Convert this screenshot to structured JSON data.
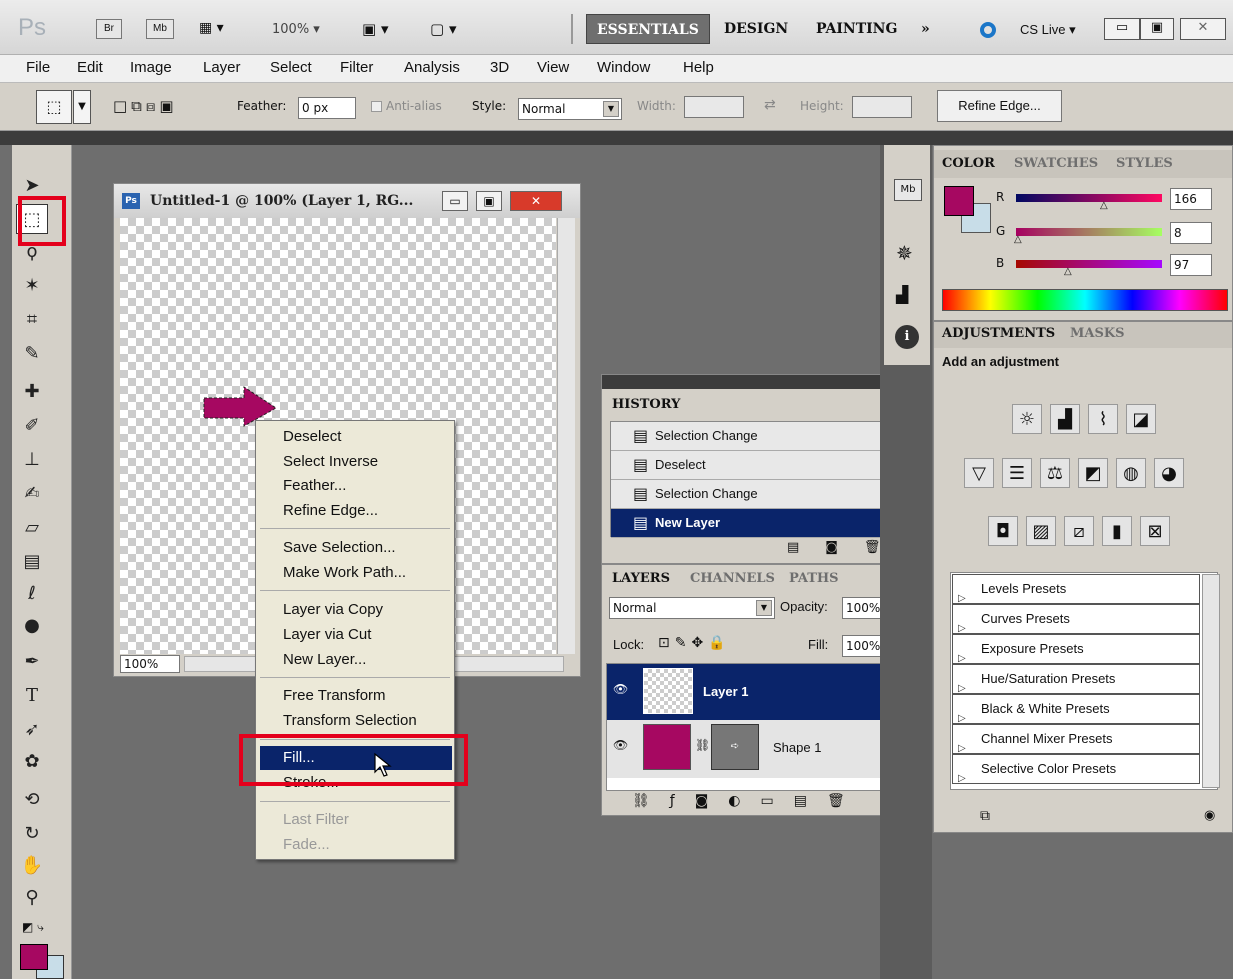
{
  "app_bar": {
    "logo": "Ps",
    "bridge": "Br",
    "minibridge": "Mb",
    "zoom": "100%",
    "workspaces": [
      "ESSENTIALS",
      "DESIGN",
      "PAINTING"
    ],
    "more": "»",
    "cs_live": "CS Live"
  },
  "menu": [
    "File",
    "Edit",
    "Image",
    "Layer",
    "Select",
    "Filter",
    "Analysis",
    "3D",
    "View",
    "Window",
    "Help"
  ],
  "options": {
    "feather_label": "Feather:",
    "feather_value": "0 px",
    "antialias": "Anti-alias",
    "style_label": "Style:",
    "style_value": "Normal",
    "width_label": "Width:",
    "height_label": "Height:",
    "refine_edge": "Refine Edge..."
  },
  "document": {
    "icon": "Ps",
    "title": "Untitled-1 @ 100% (Layer 1, RG...",
    "zoom": "100%"
  },
  "context_menu": {
    "groups": [
      [
        "Deselect",
        "Select Inverse",
        "Feather...",
        "Refine Edge..."
      ],
      [
        "Save Selection...",
        "Make Work Path..."
      ],
      [
        "Layer via Copy",
        "Layer via Cut",
        "New Layer..."
      ],
      [
        "Free Transform",
        "Transform Selection"
      ],
      [
        "Fill...",
        "Stroke..."
      ],
      [
        "Last Filter",
        "Fade..."
      ]
    ]
  },
  "color_panel": {
    "tabs": [
      "COLOR",
      "SWATCHES",
      "STYLES"
    ],
    "r_label": "R",
    "g_label": "G",
    "b_label": "B",
    "r": "166",
    "g": "8",
    "b": "97",
    "foreground": "#a60861",
    "background": "#c8dde8"
  },
  "adjustments": {
    "tabs": [
      "ADJUSTMENTS",
      "MASKS"
    ],
    "heading": "Add an adjustment",
    "presets": [
      "Levels Presets",
      "Curves Presets",
      "Exposure Presets",
      "Hue/Saturation Presets",
      "Black & White Presets",
      "Channel Mixer Presets",
      "Selective Color Presets"
    ]
  },
  "history": {
    "tab": "HISTORY",
    "items": [
      "Selection Change",
      "Deselect",
      "Selection Change",
      "New Layer"
    ]
  },
  "layers": {
    "tabs": [
      "LAYERS",
      "CHANNELS",
      "PATHS"
    ],
    "blend": "Normal",
    "opacity_label": "Opacity:",
    "opacity": "100%",
    "lock_label": "Lock:",
    "fill_label": "Fill:",
    "fill": "100%",
    "items": [
      "Layer 1",
      "Shape 1"
    ]
  }
}
